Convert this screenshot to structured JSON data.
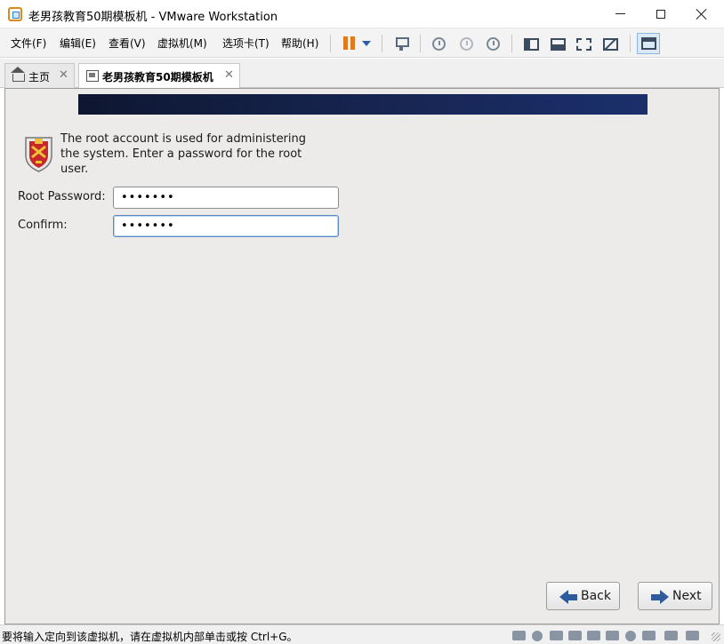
{
  "window": {
    "title": "老男孩教育50期模板机 - VMware Workstation"
  },
  "menu": [
    {
      "label": "文件(F)"
    },
    {
      "label": "编辑(E)"
    },
    {
      "label": "查看(V)"
    },
    {
      "label": "虚拟机(M)"
    },
    {
      "label": "选项卡(T)"
    },
    {
      "label": "帮助(H)"
    }
  ],
  "tabs": [
    {
      "label": "主页",
      "icon": "home-icon"
    },
    {
      "label": "老男孩教育50期模板机",
      "icon": "vm-icon"
    }
  ],
  "installer": {
    "banner_color": "#16244f",
    "intro": "The root account is used for administering the system.  Enter a password for the root user.",
    "root_password_label": "Root Password:",
    "root_password_value": "•••••••",
    "confirm_label": "Confirm:",
    "confirm_value": "•••••••",
    "back_label": "Back",
    "next_label": "Next"
  },
  "status": {
    "text": "要将输入定向到该虚拟机，请在虚拟机内部单击或按 Ctrl+G。"
  },
  "colors": {
    "accent": "#2f5a9c",
    "pause": "#e07a1f"
  }
}
